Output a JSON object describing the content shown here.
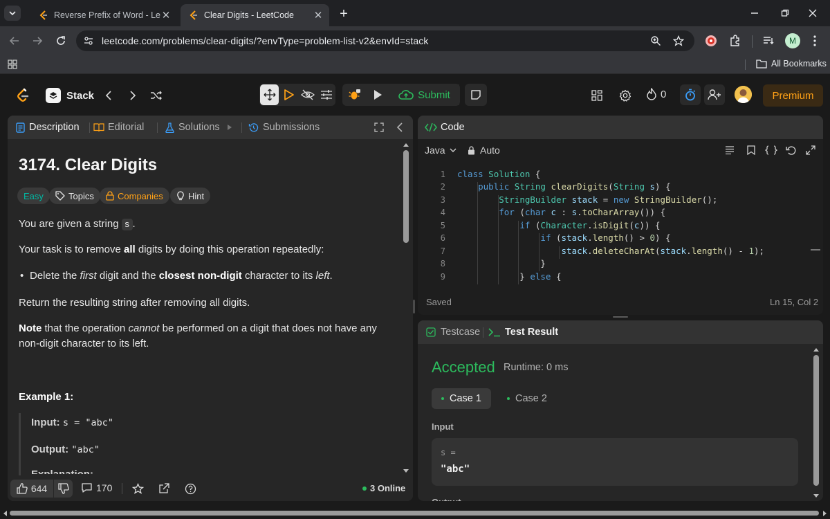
{
  "browser": {
    "tabs": [
      {
        "title": "Reverse Prefix of Word - LeetCo",
        "active": false
      },
      {
        "title": "Clear Digits - LeetCode",
        "active": true
      }
    ],
    "url": "leetcode.com/problems/clear-digits/?envType=problem-list-v2&envId=stack",
    "profile_initial": "M",
    "bookmarks_label": "All Bookmarks"
  },
  "navbar": {
    "list_name": "Stack",
    "submit_label": "Submit",
    "streak_count": "0",
    "premium_label": "Premium"
  },
  "description_panel": {
    "tabs": [
      "Description",
      "Editorial",
      "Solutions",
      "Submissions"
    ],
    "title": "3174. Clear Digits",
    "difficulty": "Easy",
    "tags": [
      "Topics",
      "Companies",
      "Hint"
    ],
    "intro_prefix": "You are given a string ",
    "intro_code": "s",
    "intro_suffix": ".",
    "task_prefix": "Your task is to remove ",
    "task_bold": "all",
    "task_suffix": " digits by doing this operation repeatedly:",
    "bullet_1": "Delete the ",
    "bullet_first": "first",
    "bullet_2": " digit and the ",
    "bullet_bold": "closest non-digit",
    "bullet_3": " character to its ",
    "bullet_left": "left",
    "bullet_4": ".",
    "return_text": "Return the resulting string after removing all digits.",
    "note_bold": "Note",
    "note_1": " that the operation ",
    "note_cannot": "cannot",
    "note_2": " be performed on a digit that does not have any",
    "note_line2": "non-digit character to its left.",
    "example_title": "Example 1:",
    "input_label": "Input:",
    "input_value": "s = \"abc\"",
    "output_label": "Output:",
    "output_value": "\"abc\"",
    "explanation_label": "Explanation:",
    "likes": "644",
    "comments": "170",
    "online": "3 Online"
  },
  "code_panel": {
    "title": "Code",
    "language": "Java",
    "mode": "Auto",
    "saved": "Saved",
    "cursor": "Ln 15, Col 2",
    "line_numbers": [
      "1",
      "2",
      "3",
      "4",
      "5",
      "6",
      "7",
      "8",
      "9"
    ]
  },
  "result_panel": {
    "tabs": [
      "Testcase",
      "Test Result"
    ],
    "status": "Accepted",
    "runtime": "Runtime: 0 ms",
    "cases": [
      "Case 1",
      "Case 2"
    ],
    "input_label": "Input",
    "param_name": "s =",
    "param_value": "\"abc\"",
    "output_label": "Output"
  },
  "colors": {
    "accent": "#ffa116",
    "accepted": "#2cbb5d",
    "easy": "#00b8a3"
  }
}
